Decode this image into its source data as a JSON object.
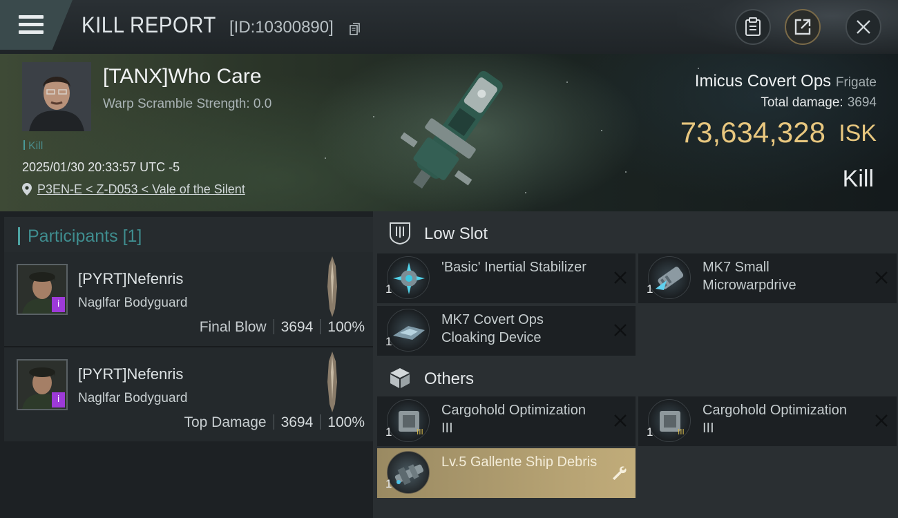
{
  "header": {
    "title": "KILL REPORT",
    "report_id": "[ID:10300890]"
  },
  "victim": {
    "name": "[TANX]Who Care",
    "warp_scramble": "Warp Scramble Strength: 0.0",
    "tag": "Kill",
    "time": "2025/01/30 20:33:57 UTC -5",
    "location": "P3EN-E < Z-D053 < Vale of the Silent",
    "ship": "Imicus Covert Ops",
    "ship_class": "Frigate",
    "total_damage_label": "Total damage:",
    "total_damage": "3694",
    "isk_value": "73,634,328",
    "isk_unit": "ISK",
    "result": "Kill"
  },
  "participants": {
    "label": "Participants",
    "count": "[1]",
    "rows": [
      {
        "name": "[PYRT]Nefenris",
        "ship": "Naglfar Bodyguard",
        "role": "Final Blow",
        "damage": "3694",
        "percent": "100%",
        "badge": "i"
      },
      {
        "name": "[PYRT]Nefenris",
        "ship": "Naglfar Bodyguard",
        "role": "Top Damage",
        "damage": "3694",
        "percent": "100%",
        "badge": "i"
      }
    ]
  },
  "sections": {
    "low_slot": {
      "title": "Low Slot",
      "items": [
        {
          "name": "'Basic' Inertial Stabilizer",
          "qty": "1"
        },
        {
          "name": "MK7 Small Microwarpdrive",
          "qty": "1"
        },
        {
          "name": "MK7 Covert Ops Cloaking Device",
          "qty": "1"
        }
      ]
    },
    "others": {
      "title": "Others",
      "items": [
        {
          "name": "Cargohold Optimization III",
          "qty": "1"
        },
        {
          "name": "Cargohold Optimization III",
          "qty": "1"
        },
        {
          "name": "Lv.5 Gallente Ship Debris",
          "qty": "1"
        }
      ]
    }
  },
  "icons": [
    "menu-icon",
    "copy-icon",
    "clipboard-icon",
    "share-icon",
    "close-icon",
    "location-pin-icon",
    "low-slot-icon",
    "cargo-box-icon",
    "remove-icon",
    "wrench-icon"
  ],
  "colors": {
    "accent_teal": "#4ea3a3",
    "isk_gold": "#e8c77f",
    "badge_purple": "#9d3ad8",
    "dropped_gold": "#c1ac7a"
  }
}
